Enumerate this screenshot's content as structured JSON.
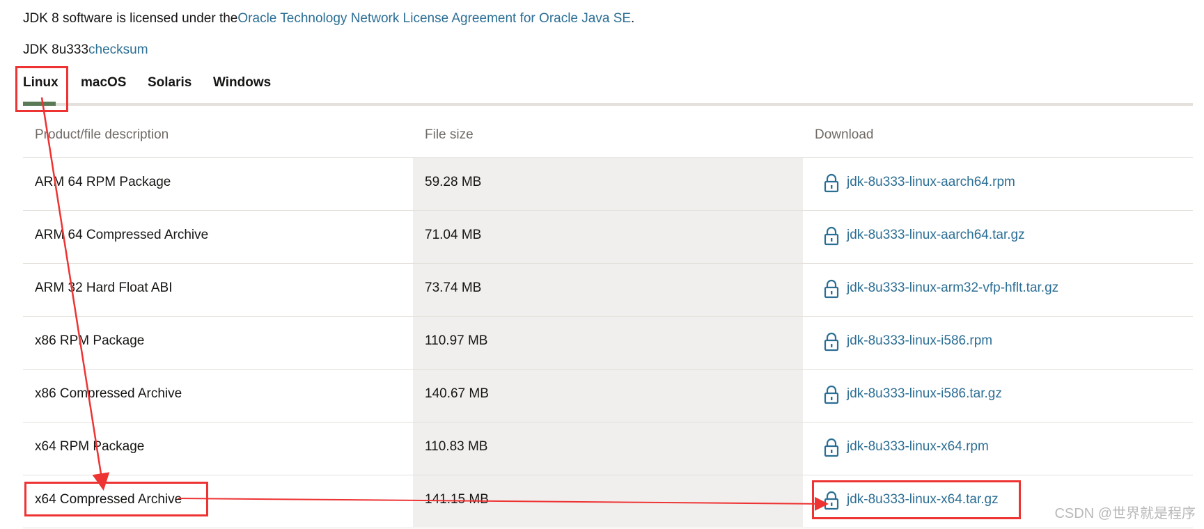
{
  "license": {
    "prefix": "JDK 8 software is licensed under the",
    "link": "Oracle Technology Network License Agreement for Oracle Java SE",
    "suffix": "."
  },
  "checksum": {
    "prefix": "JDK 8u333",
    "link": "checksum"
  },
  "tabs": [
    {
      "label": "Linux",
      "active": true
    },
    {
      "label": "macOS",
      "active": false
    },
    {
      "label": "Solaris",
      "active": false
    },
    {
      "label": "Windows",
      "active": false
    }
  ],
  "table": {
    "headers": [
      "Product/file description",
      "File size",
      "Download"
    ],
    "rows": [
      {
        "description": "ARM 64 RPM Package",
        "size": "59.28 MB",
        "file": "jdk-8u333-linux-aarch64.rpm"
      },
      {
        "description": "ARM 64 Compressed Archive",
        "size": "71.04 MB",
        "file": "jdk-8u333-linux-aarch64.tar.gz"
      },
      {
        "description": "ARM 32 Hard Float ABI",
        "size": "73.74 MB",
        "file": "jdk-8u333-linux-arm32-vfp-hflt.tar.gz"
      },
      {
        "description": "x86 RPM Package",
        "size": "110.97 MB",
        "file": "jdk-8u333-linux-i586.rpm"
      },
      {
        "description": "x86 Compressed Archive",
        "size": "140.67 MB",
        "file": "jdk-8u333-linux-i586.tar.gz"
      },
      {
        "description": "x64 RPM Package",
        "size": "110.83 MB",
        "file": "jdk-8u333-linux-x64.rpm"
      },
      {
        "description": "x64 Compressed Archive",
        "size": "141.15 MB",
        "file": "jdk-8u333-linux-x64.tar.gz"
      }
    ]
  },
  "icons": {
    "download": "lock-icon"
  },
  "colors": {
    "link": "#2b6e94",
    "active_tab": "#5a7a56",
    "annotation": "#e33333"
  },
  "watermark": "CSDN @世界就是程序"
}
